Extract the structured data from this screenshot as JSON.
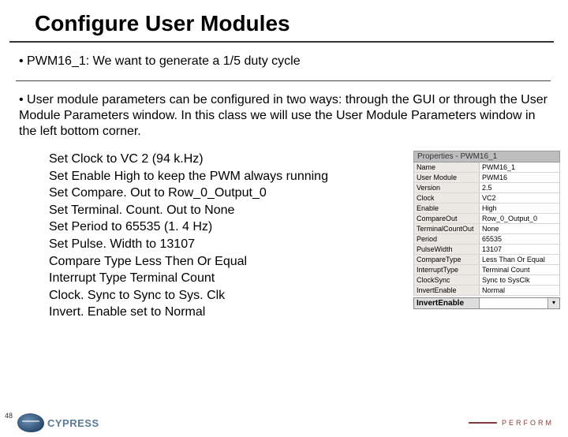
{
  "title": "Configure User Modules",
  "bullet1": "• PWM16_1: We want to generate a 1/5 duty cycle",
  "bullet2": "• User module parameters can be configured in two ways: through the GUI or through the User Module Parameters window.  In this class we will use the User Module Parameters window in the left bottom corner.",
  "instr": [
    "Set Clock to VC 2 (94 k.Hz)",
    "Set Enable High to keep the PWM always running",
    "Set Compare. Out to Row_0_Output_0",
    "Set Terminal. Count. Out to None",
    "Set Period to  65535 (1. 4 Hz)",
    "Set Pulse. Width to 13107",
    "Compare Type Less Then Or Equal",
    "Interrupt Type Terminal Count",
    "Clock. Sync to Sync to Sys. Clk",
    "Invert. Enable set to Normal"
  ],
  "props": {
    "title": "Properties - PWM16_1",
    "rows": [
      {
        "l": "Name",
        "v": "PWM16_1"
      },
      {
        "l": "User Module",
        "v": "PWM16"
      },
      {
        "l": "Version",
        "v": "2.5"
      },
      {
        "l": "Clock",
        "v": "VC2"
      },
      {
        "l": "Enable",
        "v": "High"
      },
      {
        "l": "CompareOut",
        "v": "Row_0_Output_0"
      },
      {
        "l": "TerminalCountOut",
        "v": "None"
      },
      {
        "l": "Period",
        "v": "65535"
      },
      {
        "l": "PulseWidth",
        "v": "13107"
      },
      {
        "l": "CompareType",
        "v": "Less Than Or Equal"
      },
      {
        "l": "InterruptType",
        "v": "Terminal Count"
      },
      {
        "l": "ClockSync",
        "v": "Sync to SysClk"
      },
      {
        "l": "InvertEnable",
        "v": "Normal"
      }
    ],
    "select_label": "InvertEnable",
    "select_value": ""
  },
  "footer": {
    "page": "48",
    "logo_text": "CYPRESS",
    "perform": "PERFORM"
  }
}
